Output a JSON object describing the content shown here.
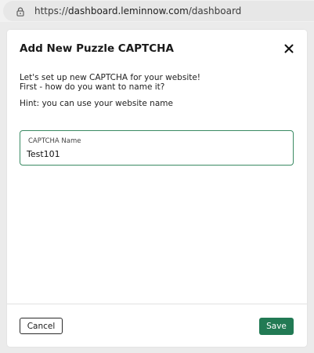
{
  "browser": {
    "url_scheme": "https://",
    "url_host": "dashboard.leminnow.com",
    "url_path": "/dashboard",
    "lock_icon": "lock-icon"
  },
  "dialog": {
    "title": "Add New Puzzle CAPTCHA",
    "close_icon": "close-icon",
    "intro_line1": "Let's set up new CAPTCHA for your website!",
    "intro_line2": "First - how do you want to name it?",
    "hint": "Hint: you can use your website name",
    "field": {
      "label": "CAPTCHA Name",
      "value": "Test101"
    },
    "cancel_label": "Cancel",
    "save_label": "Save"
  },
  "colors": {
    "accent": "#227a54",
    "field_border": "#3a8a63"
  }
}
